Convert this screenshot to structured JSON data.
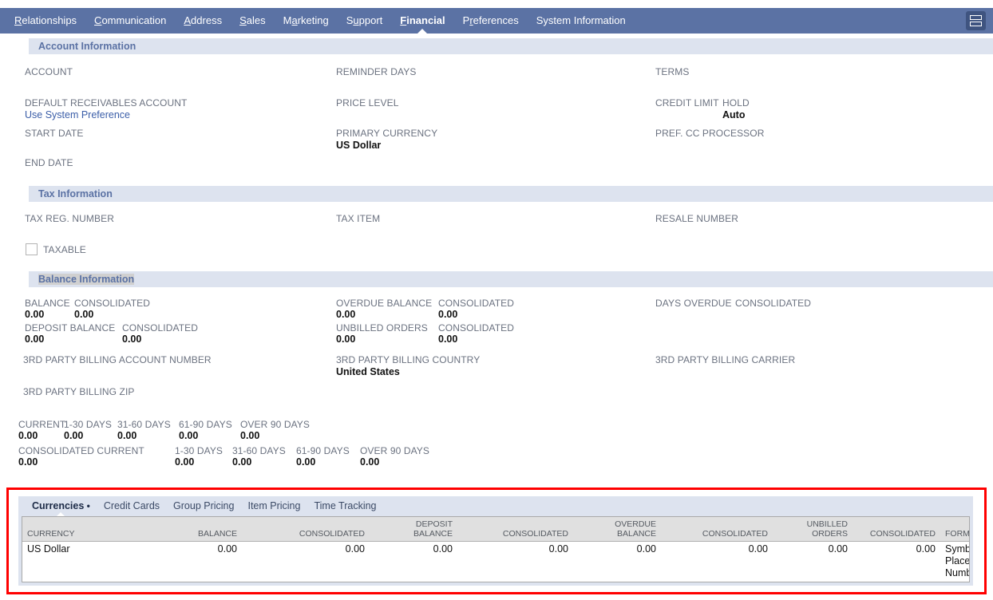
{
  "cutoff": {
    "fragments": [
      "",
      "",
      "",
      "",
      "",
      ""
    ]
  },
  "navbar": {
    "tabs": [
      {
        "acc": "R",
        "rest": "elationships",
        "pre": ""
      },
      {
        "acc": "C",
        "rest": "ommunication",
        "pre": ""
      },
      {
        "acc": "A",
        "rest": "ddress",
        "pre": ""
      },
      {
        "acc": "S",
        "rest": "ales",
        "pre": ""
      },
      {
        "pre": "M",
        "acc": "a",
        "rest": "rketing"
      },
      {
        "pre": "S",
        "acc": "u",
        "rest": "pport"
      },
      {
        "acc": "F",
        "rest": "inancial",
        "pre": ""
      },
      {
        "pre": "P",
        "acc": "r",
        "rest": "eferences"
      },
      {
        "acc": "",
        "rest": "System Information",
        "pre": ""
      }
    ],
    "active_tab": "Financial",
    "menu_icon": "hamburger-icon"
  },
  "sections": {
    "account": {
      "title": "Account Information",
      "fields": [
        {
          "label": "ACCOUNT",
          "value": ""
        },
        {
          "label": "REMINDER DAYS",
          "value": ""
        },
        {
          "label": "TERMS",
          "value": ""
        },
        {
          "label": "DEFAULT RECEIVABLES ACCOUNT",
          "value": "Use System Preference"
        },
        {
          "label": "PRICE LEVEL",
          "value": ""
        },
        {
          "label": "CREDIT LIMIT",
          "value": ""
        },
        {
          "label": "HOLD",
          "value": "Auto"
        },
        {
          "label": "START DATE",
          "value": ""
        },
        {
          "label": "PRIMARY CURRENCY",
          "value": "US Dollar"
        },
        {
          "label": "PREF. CC PROCESSOR",
          "value": ""
        },
        {
          "label": "END DATE",
          "value": ""
        }
      ]
    },
    "tax": {
      "title": "Tax Information",
      "fields": [
        {
          "label": "TAX REG. NUMBER",
          "value": ""
        },
        {
          "label": "TAX ITEM",
          "value": ""
        },
        {
          "label": "RESALE NUMBER",
          "value": ""
        },
        {
          "label": "TAXABLE",
          "value": "",
          "checked": false
        }
      ]
    },
    "balance": {
      "title": "Balance Information",
      "fields": [
        {
          "label": "BALANCE",
          "value": "0.00"
        },
        {
          "label": "CONSOLIDATED",
          "value": "0.00"
        },
        {
          "label": "OVERDUE BALANCE",
          "value": "0.00"
        },
        {
          "label": "CONSOLIDATED",
          "value": "0.00"
        },
        {
          "label": "DAYS OVERDUE",
          "value": ""
        },
        {
          "label": "CONSOLIDATED",
          "value": ""
        },
        {
          "label": "DEPOSIT BALANCE",
          "value": "0.00"
        },
        {
          "label": "CONSOLIDATED",
          "value": "0.00"
        },
        {
          "label": "UNBILLED ORDERS",
          "value": "0.00"
        },
        {
          "label": "CONSOLIDATED",
          "value": "0.00"
        },
        {
          "label": "3RD PARTY BILLING ACCOUNT NUMBER",
          "value": ""
        },
        {
          "label": "3RD PARTY BILLING COUNTRY",
          "value": "United States"
        },
        {
          "label": "3RD PARTY BILLING CARRIER",
          "value": ""
        },
        {
          "label": "3RD PARTY BILLING ZIP",
          "value": ""
        }
      ],
      "aging": [
        {
          "label": "CURRENT",
          "value": "0.00"
        },
        {
          "label": "1-30 DAYS",
          "value": "0.00"
        },
        {
          "label": "31-60 DAYS",
          "value": "0.00"
        },
        {
          "label": "61-90 DAYS",
          "value": "0.00"
        },
        {
          "label": "OVER 90 DAYS",
          "value": "0.00"
        }
      ],
      "aging_consolidated": [
        {
          "label": "CONSOLIDATED CURRENT",
          "value": "0.00"
        },
        {
          "label": "1-30 DAYS",
          "value": "0.00"
        },
        {
          "label": "31-60 DAYS",
          "value": "0.00"
        },
        {
          "label": "61-90 DAYS",
          "value": "0.00"
        },
        {
          "label": "OVER 90 DAYS",
          "value": "0.00"
        }
      ]
    }
  },
  "subtabs": {
    "items": [
      {
        "label": "Currencies",
        "marker": " •",
        "active": true
      },
      {
        "label": "Credit Cards",
        "marker": "",
        "active": false
      },
      {
        "label": "Group Pricing",
        "marker": "",
        "active": false
      },
      {
        "label": "Item Pricing",
        "marker": "",
        "active": false
      },
      {
        "label": "Time Tracking",
        "marker": "",
        "active": false
      }
    ]
  },
  "grid": {
    "columns": [
      "CURRENCY",
      "BALANCE",
      "CONSOLIDATED",
      [
        "DEPOSIT",
        "BALANCE"
      ],
      "CONSOLIDATED",
      [
        "OVERDUE",
        "BALANCE"
      ],
      "CONSOLIDATED",
      [
        "UNBILLED",
        "ORDERS"
      ],
      "CONSOLIDATED",
      "FORMAT"
    ],
    "rows": [
      [
        "US Dollar",
        "0.00",
        "0.00",
        "0.00",
        "0.00",
        "0.00",
        "0.00",
        "0.00",
        "0.00",
        "Symbol: $ Symbol Placement: Before Number"
      ]
    ]
  },
  "colors": {
    "nav_bar": "#5b72a4",
    "section_header_bg": "#dde3ef",
    "section_header_text": "#5b72a4",
    "link": "#3b5ea8",
    "highlight_box": "#ff0000",
    "grid_header_bg": "#e0e0e0",
    "selection_highlight": "#d0d0d0"
  }
}
